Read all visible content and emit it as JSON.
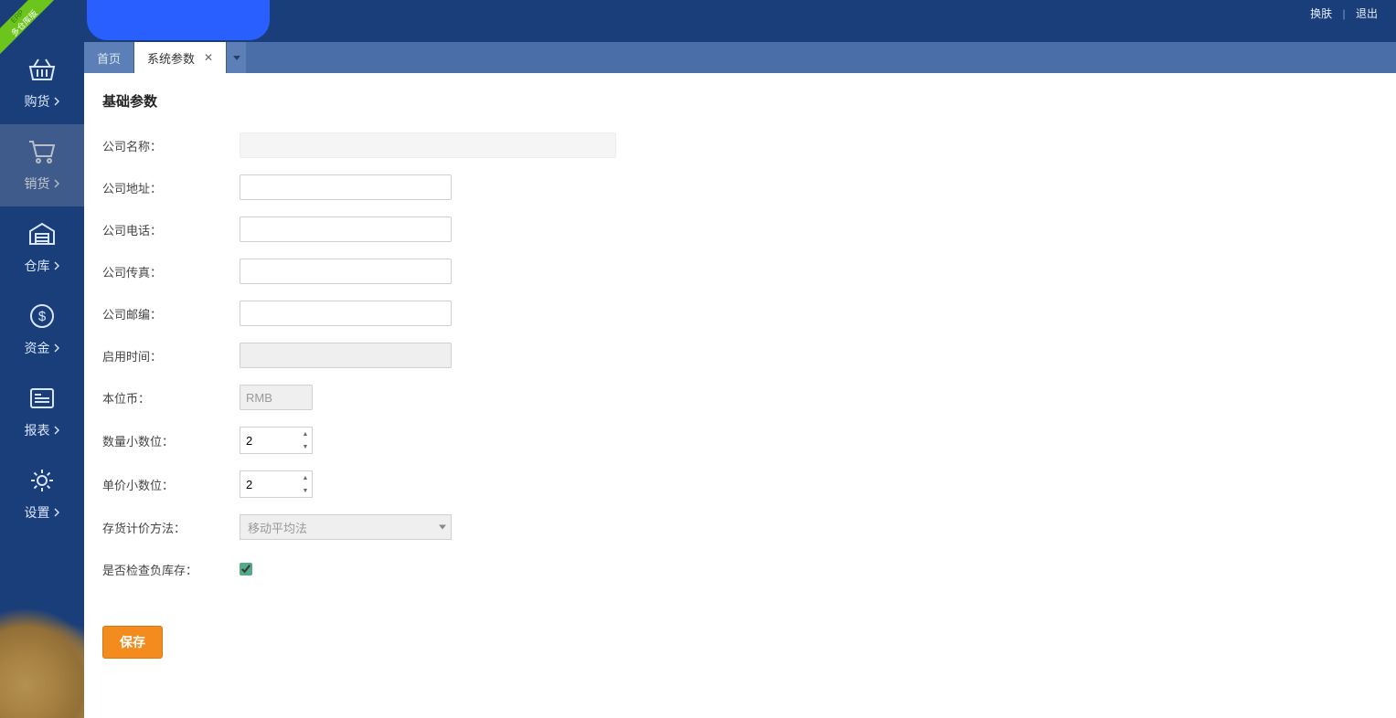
{
  "corner_badge": {
    "line1": "ERP",
    "line2": "多仓库版"
  },
  "header": {
    "skin_link": "换肤",
    "logout_link": "退出"
  },
  "sidebar": {
    "items": [
      {
        "label": "购货",
        "has_chevron": true
      },
      {
        "label": "销货",
        "has_chevron": true
      },
      {
        "label": "仓库",
        "has_chevron": true
      },
      {
        "label": "资金",
        "has_chevron": true
      },
      {
        "label": "报表",
        "has_chevron": true
      },
      {
        "label": "设置",
        "has_chevron": true
      }
    ]
  },
  "tabs": {
    "items": [
      {
        "label": "首页",
        "closable": false,
        "active": false
      },
      {
        "label": "系统参数",
        "closable": true,
        "active": true
      }
    ]
  },
  "form": {
    "section_title": "基础参数",
    "rows": {
      "company_name": {
        "label": "公司名称：",
        "value": ""
      },
      "company_address": {
        "label": "公司地址：",
        "value": ""
      },
      "company_phone": {
        "label": "公司电话：",
        "value": ""
      },
      "company_fax": {
        "label": "公司传真：",
        "value": ""
      },
      "company_zip": {
        "label": "公司邮编：",
        "value": ""
      },
      "enable_time": {
        "label": "启用时间：",
        "value": ""
      },
      "base_currency": {
        "label": "本位币：",
        "value": "RMB"
      },
      "qty_decimals": {
        "label": "数量小数位：",
        "value": "2"
      },
      "price_decimals": {
        "label": "单价小数位：",
        "value": "2"
      },
      "inventory_method": {
        "label": "存货计价方法：",
        "value": "移动平均法"
      },
      "check_negative_stock": {
        "label": "是否检查负库存：",
        "checked": true
      }
    },
    "save_button": "保存"
  }
}
